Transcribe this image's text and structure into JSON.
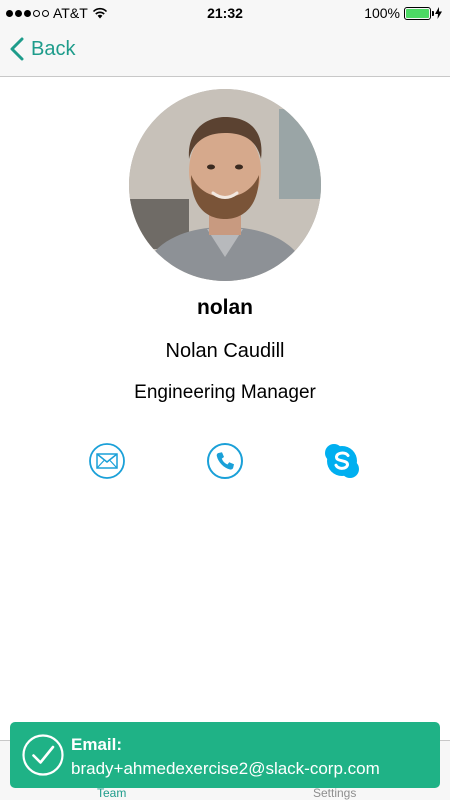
{
  "status_bar": {
    "carrier": "AT&T",
    "time": "21:32",
    "battery": "100%",
    "signal_bars_filled": 3,
    "signal_bars_total": 5,
    "battery_level": 1.0,
    "icons": [
      "signal-dots-icon",
      "wifi-icon",
      "battery-icon",
      "charging-bolt-icon"
    ]
  },
  "nav": {
    "back_label": "Back",
    "back_icon": "chevron-left-icon"
  },
  "profile": {
    "avatar_icon": "profile-photo",
    "username": "nolan",
    "full_name": "Nolan Caudill",
    "title": "Engineering Manager"
  },
  "contact_actions": [
    {
      "icon": "email-icon"
    },
    {
      "icon": "phone-icon"
    },
    {
      "icon": "skype-icon"
    }
  ],
  "tab_bar": {
    "tabs": [
      {
        "label": "Team",
        "active": true
      },
      {
        "label": "Settings",
        "active": false
      }
    ]
  },
  "toast": {
    "icon": "checkmark-circle-icon",
    "title": "Email:",
    "message": "brady+ahmedexercise2@slack-corp.com"
  },
  "colors": {
    "accent": "#1e9c8b",
    "icon_blue": "#1aa0d8",
    "skype_blue": "#00aff0",
    "toast_green": "#1fb286",
    "bar_bg": "#f7f7f7"
  }
}
